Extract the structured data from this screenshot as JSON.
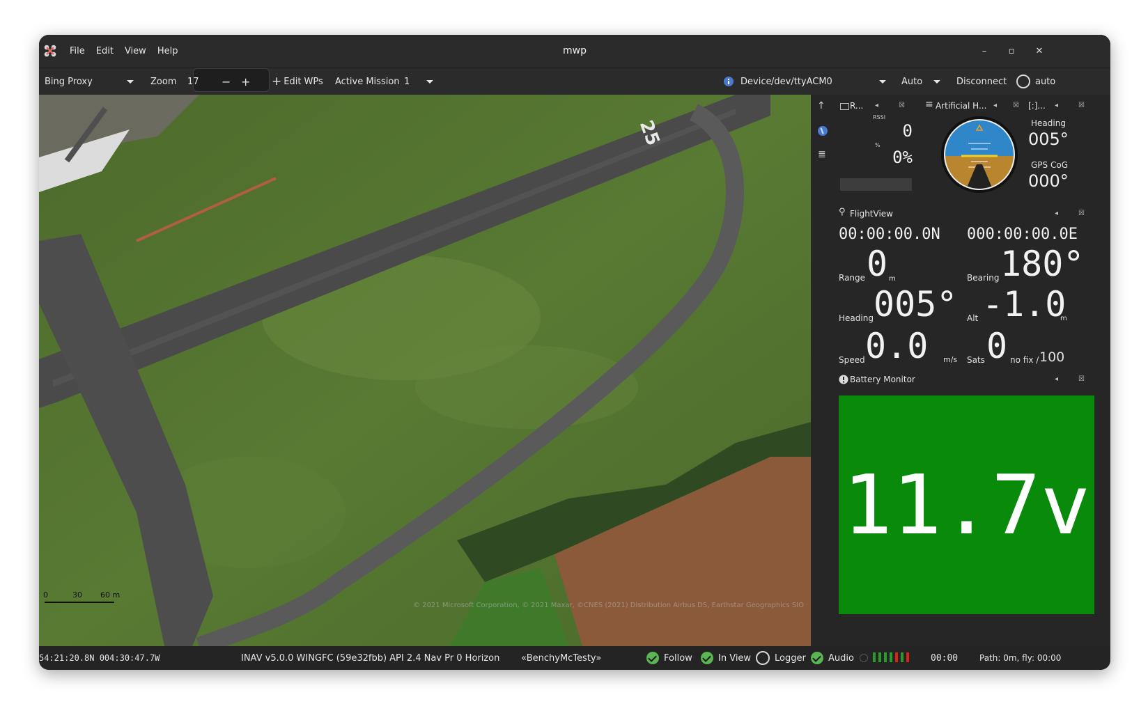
{
  "app": {
    "title": "mwp",
    "menu": [
      "File",
      "Edit",
      "View",
      "Help"
    ]
  },
  "toolbar": {
    "map_source": "Bing Proxy",
    "zoom_label": "Zoom",
    "zoom_value": "17",
    "zoom_minus": "−",
    "zoom_plus": "+",
    "edit_wps": "Edit WPs",
    "active_mission_label": "Active Mission",
    "active_mission_value": "1",
    "device_label": "Device",
    "device_value": "/dev/ttyACM0",
    "protocol": "Auto",
    "disconnect": "Disconnect",
    "auto_label": "auto"
  },
  "map": {
    "scale": [
      "0",
      "30",
      "60 m"
    ],
    "attribution": "© 2021 Microsoft Corporation, © 2021 Maxar, ©CNES (2021) Distribution Airbus DS, Earthstar Geographics  SIO",
    "runway_marking": "25"
  },
  "rssi_panel": {
    "title": "R...",
    "rssi_label": "RSSI",
    "rssi_value": "0",
    "pct_label": "%",
    "pct_value": "0%"
  },
  "ahi_panel": {
    "title": "Artificial H..."
  },
  "direction_panel": {
    "title": "[:]...",
    "heading_label": "Heading",
    "heading_value": "005°",
    "cog_label": "GPS CoG",
    "cog_value": "000°"
  },
  "flightview": {
    "title": "FlightView",
    "lat": "00:00:00.0N",
    "lon": "000:00:00.0E",
    "range_label": "Range",
    "range_value": "0",
    "range_unit": "m",
    "bearing_label": "Bearing",
    "bearing_value": "180°",
    "heading_label": "Heading",
    "heading_value": "005°",
    "alt_label": "Alt",
    "alt_value": "-1.0",
    "alt_unit": "m",
    "speed_label": "Speed",
    "speed_value": "0.0",
    "speed_unit": "m/s",
    "sats_label": "Sats",
    "sats_value": "0",
    "fix_text": "no fix /",
    "fix_value": "100"
  },
  "battery": {
    "title": "Battery Monitor",
    "voltage": "11.7v",
    "color": "#0a8a0a"
  },
  "status": {
    "position": "54:21:20.8N 004:30:47.7W",
    "fc_info": "INAV v5.0.0  WINGFC (59e32fbb) API 2.4 Nav Pr 0 Horizon",
    "craft_name": "«BenchyMcTesty»",
    "follow": "Follow",
    "in_view": "In View",
    "logger": "Logger",
    "audio": "Audio",
    "timer": "00:00",
    "path": "Path: 0m, fly: 00:00"
  }
}
